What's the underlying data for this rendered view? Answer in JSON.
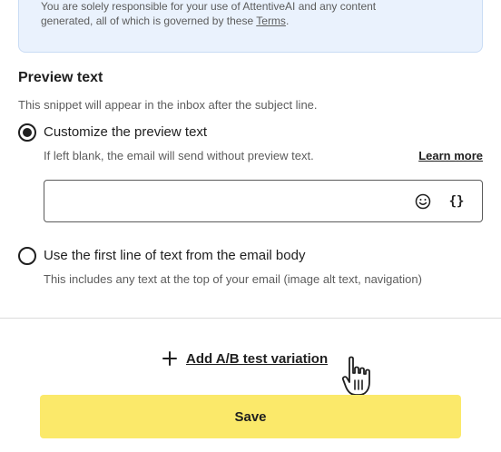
{
  "notice": {
    "line1": "You are solely responsible for your use of AttentiveAI and any content",
    "line2": "generated, all of which is governed by these ",
    "terms_link": "Terms",
    "period": "."
  },
  "preview": {
    "title": "Preview text",
    "description": "This snippet will appear in the inbox after the subject line.",
    "option_custom": {
      "label": "Customize the preview text",
      "helper": "If left blank, the email will send without preview text.",
      "checked": true
    },
    "learn_more": "Learn more",
    "input_value": "",
    "input_placeholder": "",
    "braces_glyph": "{}",
    "option_first_line": {
      "label": "Use the first line of text from the email body",
      "helper": "This includes any text at the top of your email (image alt text, navigation)",
      "checked": false
    }
  },
  "ab_test": {
    "label": "Add A/B test variation"
  },
  "save": {
    "label": "Save"
  },
  "colors": {
    "notice_bg": "#eaf2fd",
    "save_bg": "#fbe96a",
    "text_primary": "#1f1f1f",
    "text_secondary": "#5c5c5c"
  },
  "icons": [
    "smile-emoji-icon",
    "braces-icon",
    "plus-icon",
    "hand-pointer-cursor-icon"
  ]
}
